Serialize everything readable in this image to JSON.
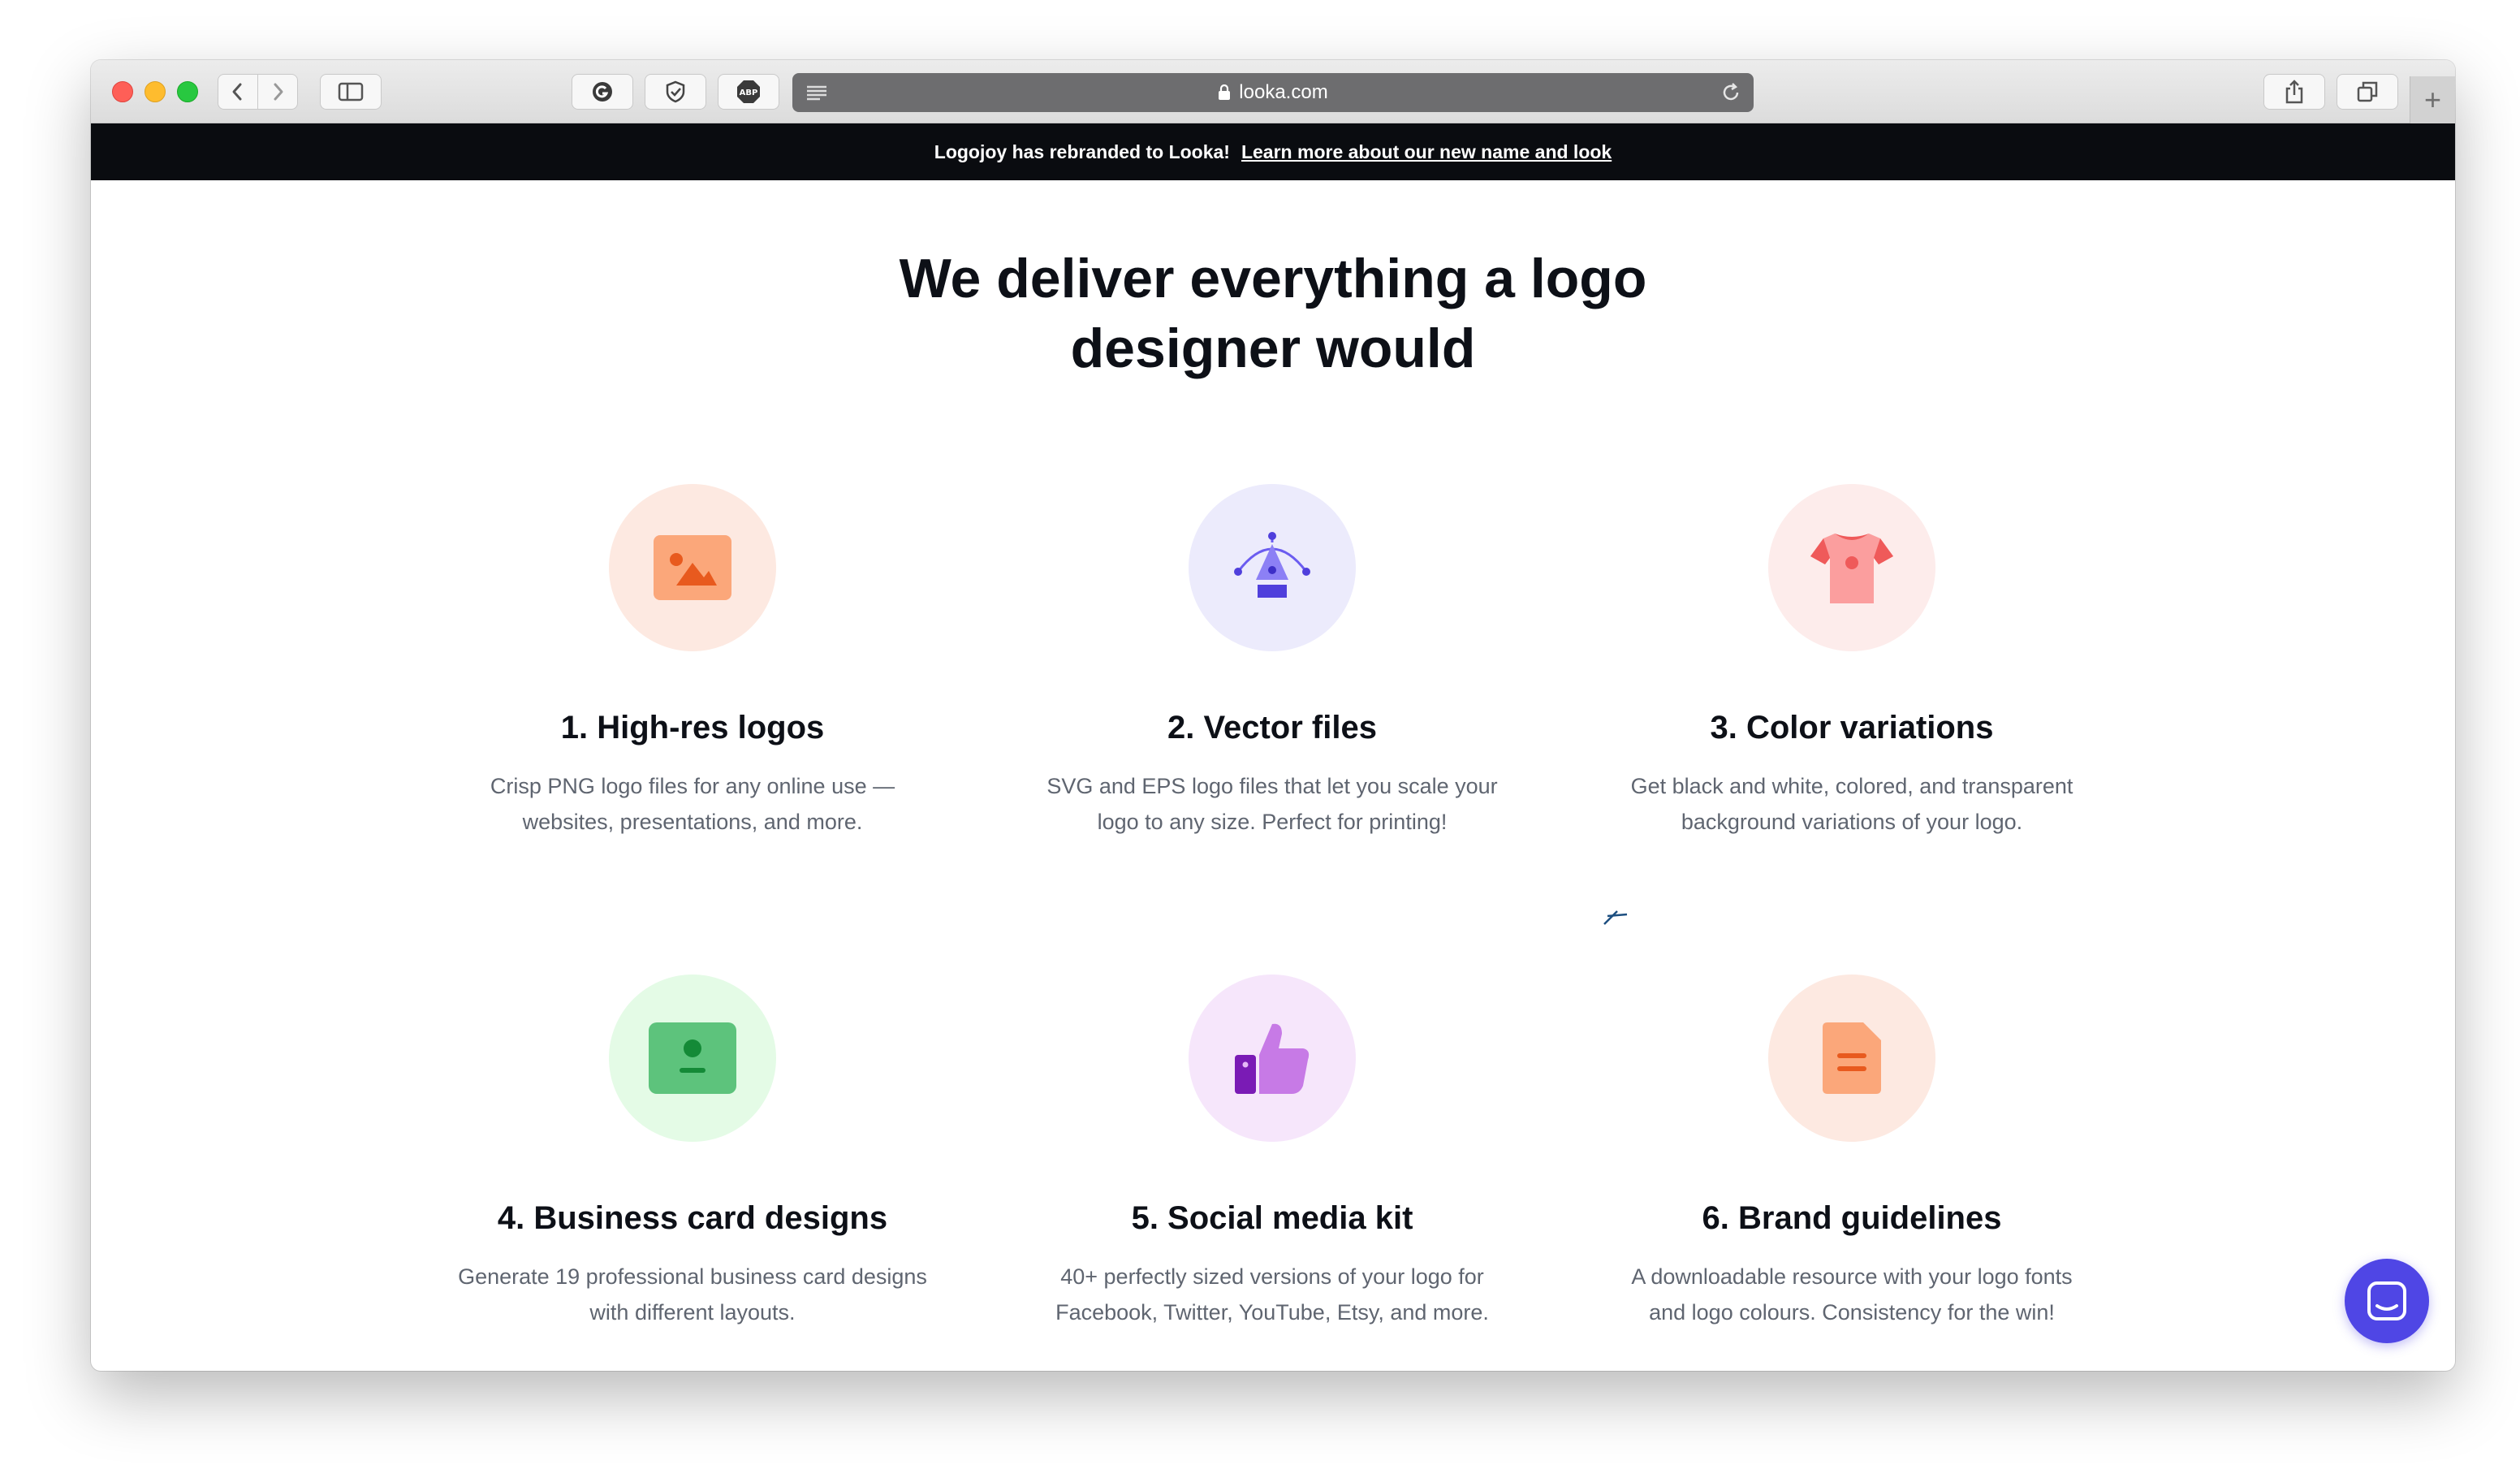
{
  "browser": {
    "url": "looka.com",
    "icons": {
      "back": "chevron-left-icon",
      "forward": "chevron-right-icon",
      "sidebar": "sidebar-icon",
      "ext1": "grammarly-icon",
      "ext2": "shield-icon",
      "ext3": "adblock-icon",
      "ext3_label": "ABP",
      "reader": "reader-icon",
      "lock": "lock-icon",
      "reload": "reload-icon",
      "share": "share-icon",
      "tabs": "tabs-icon",
      "new_tab": "plus-icon"
    },
    "new_tab_label": "+"
  },
  "banner": {
    "text": "Logojoy has rebranded to Looka!",
    "link": "Learn more about our new name and look"
  },
  "main": {
    "heading_line1": "We deliver everything a logo",
    "heading_line2": "designer would",
    "features": [
      {
        "title": "1. High-res logos",
        "desc_line1": "Crisp PNG logo files for any online use —",
        "desc_line2": "websites, presentations, and more.",
        "icon": "image-icon",
        "circle_color": "#fde9e1"
      },
      {
        "title": "2. Vector files",
        "desc_line1": "SVG and EPS logo files that let you scale your",
        "desc_line2": "logo to any size. Perfect for printing!",
        "icon": "pen-tool-icon",
        "circle_color": "#ecebfc"
      },
      {
        "title": "3. Color variations",
        "desc_line1": "Get black and white, colored, and transparent",
        "desc_line2": "background variations of your logo.",
        "icon": "tshirt-icon",
        "circle_color": "#fdeceb"
      },
      {
        "title": "4. Business card designs",
        "desc_line1": "Generate 19 professional business card designs",
        "desc_line2": "with different layouts.",
        "icon": "business-card-icon",
        "circle_color": "#e4fbe6"
      },
      {
        "title": "5. Social media kit",
        "desc_line1": "40+ perfectly sized versions of your logo for",
        "desc_line2": "Facebook, Twitter, YouTube, Etsy, and more.",
        "icon": "thumbs-up-icon",
        "circle_color": "#f6e6fb"
      },
      {
        "title": "6. Brand guidelines",
        "desc_line1": "A downloadable resource with your logo fonts",
        "desc_line2": "and logo colours. Consistency for the win!",
        "icon": "document-icon",
        "circle_color": "#fde9e1"
      }
    ]
  },
  "chat": {
    "icon": "chat-icon",
    "color": "#4f46e5"
  }
}
